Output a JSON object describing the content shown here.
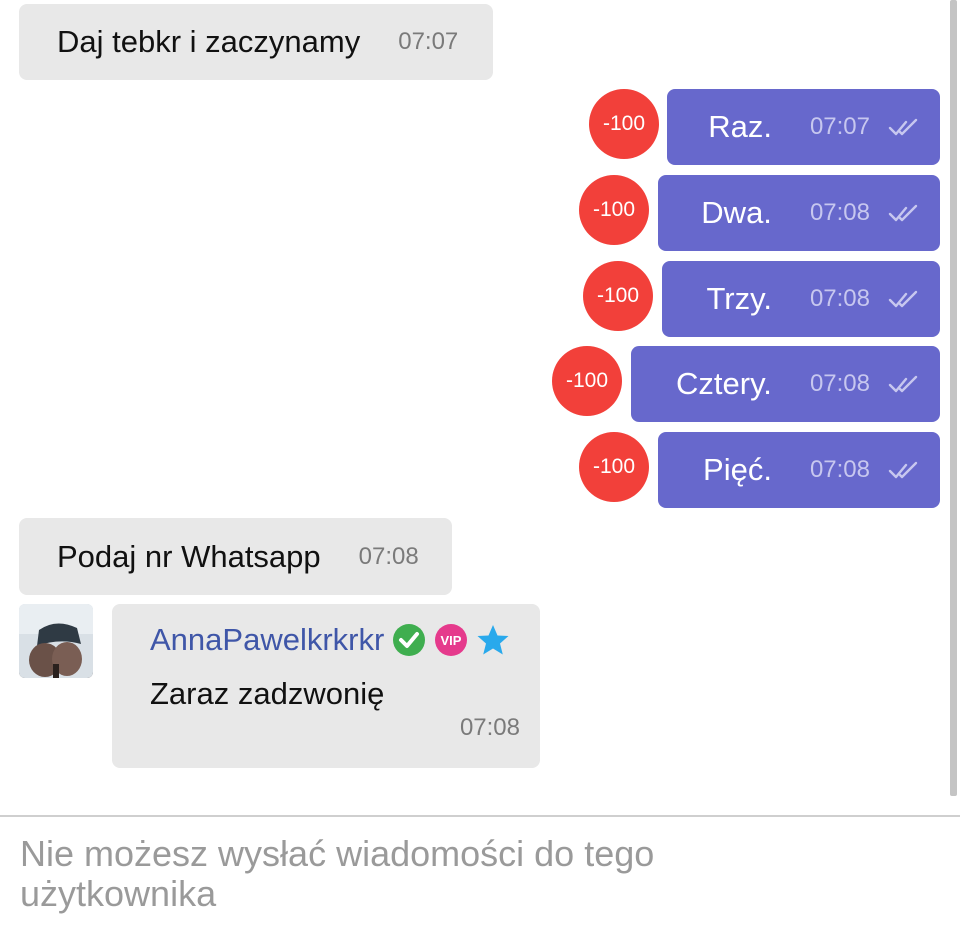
{
  "messages_incoming": [
    {
      "text": "Daj tebkr i zaczynamy",
      "time": "07:07"
    },
    {
      "text": "Podaj nr Whatsapp",
      "time": "07:08"
    }
  ],
  "messages_outgoing": [
    {
      "text": "Raz.",
      "time": "07:07",
      "badge": "-100"
    },
    {
      "text": "Dwa.",
      "time": "07:08",
      "badge": "-100"
    },
    {
      "text": "Trzy.",
      "time": "07:08",
      "badge": "-100"
    },
    {
      "text": "Cztery.",
      "time": "07:08",
      "badge": "-100"
    },
    {
      "text": "Pięć.",
      "time": "07:08",
      "badge": "-100"
    }
  ],
  "group_message": {
    "sender": "AnnaPawelkrkrkr",
    "text": "Zaraz zadzwonię",
    "time": "07:08",
    "badges": [
      "verified-check-icon",
      "vip-icon",
      "star-icon"
    ],
    "vip_label": "VIP"
  },
  "footer": {
    "notice": "Nie możesz wysłać wiadomości do tego użytkownika"
  },
  "colors": {
    "outgoing_bubble": "#6768cc",
    "incoming_bubble": "#e8e8e8",
    "badge": "#f2403a",
    "sender_name": "#3f56a8"
  }
}
